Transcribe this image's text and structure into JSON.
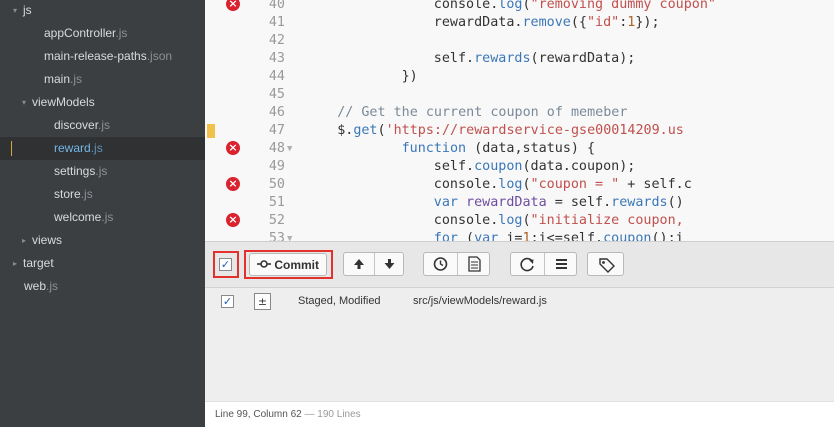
{
  "sidebar": {
    "items": [
      {
        "arrow": "▾",
        "name": "js",
        "ext": "",
        "depth": 0
      },
      {
        "arrow": "",
        "name": "appController",
        "ext": ".js",
        "depth": 1
      },
      {
        "arrow": "",
        "name": "main-release-paths",
        "ext": ".json",
        "depth": 1
      },
      {
        "arrow": "",
        "name": "main",
        "ext": ".js",
        "depth": 1
      },
      {
        "arrow": "▾",
        "name": "viewModels",
        "ext": "",
        "depth": 1
      },
      {
        "arrow": "",
        "name": "discover",
        "ext": ".js",
        "depth": 2
      },
      {
        "arrow": "",
        "name": "reward",
        "ext": ".js",
        "depth": 2,
        "selected": true
      },
      {
        "arrow": "",
        "name": "settings",
        "ext": ".js",
        "depth": 2
      },
      {
        "arrow": "",
        "name": "store",
        "ext": ".js",
        "depth": 2
      },
      {
        "arrow": "",
        "name": "welcome",
        "ext": ".js",
        "depth": 2
      },
      {
        "arrow": "▸",
        "name": "views",
        "ext": "",
        "depth": 1
      },
      {
        "arrow": "▸",
        "name": "target",
        "ext": "",
        "depth": 0
      },
      {
        "arrow": "",
        "name": "web",
        "ext": ".js",
        "depth": 0
      }
    ]
  },
  "editor": {
    "lines": [
      {
        "num": "40",
        "error": true,
        "mark": false,
        "fold": "",
        "indent": 16,
        "tokens": [
          [
            "p",
            "console."
          ],
          [
            "fn",
            "log"
          ],
          [
            "p",
            "("
          ],
          [
            "str",
            "\"removing dummy coupon\""
          ]
        ]
      },
      {
        "num": "41",
        "error": false,
        "mark": false,
        "fold": "",
        "indent": 16,
        "tokens": [
          [
            "p",
            "rewardData."
          ],
          [
            "fn",
            "remove"
          ],
          [
            "p",
            "({"
          ],
          [
            "str",
            "\"id\""
          ],
          [
            "p",
            ":"
          ],
          [
            "num",
            "1"
          ],
          [
            "p",
            "});"
          ]
        ]
      },
      {
        "num": "42",
        "error": false,
        "mark": false,
        "fold": "",
        "indent": 0,
        "tokens": []
      },
      {
        "num": "43",
        "error": false,
        "mark": false,
        "fold": "",
        "indent": 16,
        "tokens": [
          [
            "p",
            "self."
          ],
          [
            "fn",
            "rewards"
          ],
          [
            "p",
            "(rewardData);"
          ]
        ]
      },
      {
        "num": "44",
        "error": false,
        "mark": false,
        "fold": "",
        "indent": 12,
        "tokens": [
          [
            "p",
            "})"
          ]
        ]
      },
      {
        "num": "45",
        "error": false,
        "mark": false,
        "fold": "",
        "indent": 0,
        "tokens": []
      },
      {
        "num": "46",
        "error": false,
        "mark": false,
        "fold": "",
        "indent": 4,
        "tokens": [
          [
            "cm",
            "// Get the current coupon of memeber"
          ]
        ]
      },
      {
        "num": "47",
        "error": false,
        "mark": true,
        "fold": "",
        "indent": 4,
        "tokens": [
          [
            "p",
            "$."
          ],
          [
            "fn",
            "get"
          ],
          [
            "p",
            "("
          ],
          [
            "str",
            "'https://rewardservice-gse00014209.us"
          ]
        ]
      },
      {
        "num": "48",
        "error": true,
        "mark": false,
        "fold": "▼",
        "indent": 12,
        "tokens": [
          [
            "kw",
            "function"
          ],
          [
            "p",
            " (data,status) {"
          ]
        ]
      },
      {
        "num": "49",
        "error": false,
        "mark": false,
        "fold": "",
        "indent": 16,
        "tokens": [
          [
            "p",
            "self."
          ],
          [
            "fn",
            "coupon"
          ],
          [
            "p",
            "(data.coupon);"
          ]
        ]
      },
      {
        "num": "50",
        "error": true,
        "mark": false,
        "fold": "",
        "indent": 16,
        "tokens": [
          [
            "p",
            "console."
          ],
          [
            "fn",
            "log"
          ],
          [
            "p",
            "("
          ],
          [
            "str",
            "\"coupon = \""
          ],
          [
            "p",
            " + self.c"
          ]
        ]
      },
      {
        "num": "51",
        "error": false,
        "mark": false,
        "fold": "",
        "indent": 16,
        "tokens": [
          [
            "kw",
            "var"
          ],
          [
            "p",
            " "
          ],
          [
            "var",
            "rewardData"
          ],
          [
            "p",
            " = self."
          ],
          [
            "fn",
            "rewards"
          ],
          [
            "p",
            "()"
          ]
        ]
      },
      {
        "num": "52",
        "error": true,
        "mark": false,
        "fold": "",
        "indent": 16,
        "tokens": [
          [
            "p",
            "console."
          ],
          [
            "fn",
            "log"
          ],
          [
            "p",
            "("
          ],
          [
            "str",
            "\"initialize coupon,"
          ]
        ]
      },
      {
        "num": "53",
        "error": false,
        "mark": false,
        "fold": "▼",
        "indent": 16,
        "tokens": [
          [
            "kw",
            "for"
          ],
          [
            "p",
            " ("
          ],
          [
            "kw",
            "var"
          ],
          [
            "p",
            " i="
          ],
          [
            "num",
            "1"
          ],
          [
            "p",
            ";i<=self."
          ],
          [
            "fn",
            "coupon"
          ],
          [
            "p",
            "();i"
          ]
        ]
      }
    ]
  },
  "git": {
    "select_all_checked": true,
    "commit_label": "Commit",
    "commit_icon": "commit-icon",
    "toolbar_icons": [
      "arrow-up-icon",
      "arrow-down-icon",
      "history-icon",
      "file-diff-icon",
      "refresh-icon",
      "menu-icon",
      "tag-icon"
    ],
    "files": [
      {
        "checked": true,
        "icon": "file-staged-icon",
        "status": "Staged, Modified",
        "path": "src/js/viewModels/reward.js"
      }
    ]
  },
  "status_bar": {
    "position": "Line 99, Column 62",
    "separator": "—",
    "lines": "190 Lines"
  },
  "colors": {
    "sidebar_bg": "#3c3f41",
    "selected_file": "#74b7e8",
    "error": "#d9232e",
    "highlight_box": "#e3322d"
  }
}
